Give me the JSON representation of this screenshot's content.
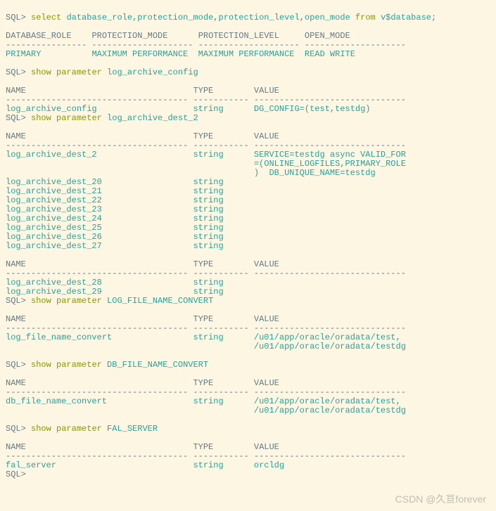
{
  "prompt": "SQL>",
  "cmd0": "select database_role,protection_mode,protection_level,open_mode from v$database;",
  "q0": {
    "hdr": [
      "DATABASE_ROLE",
      "PROTECTION_MODE",
      "PROTECTION_LEVEL",
      "OPEN_MODE"
    ],
    "dash": [
      "----------------",
      "--------------------",
      "--------------------",
      "--------------------"
    ],
    "row": [
      "PRIMARY",
      "MAXIMUM PERFORMANCE",
      "MAXIMUM PERFORMANCE",
      "READ WRITE"
    ]
  },
  "cmd1": "show parameter log_archive_config",
  "paramHdr": {
    "name": "NAME",
    "type": "TYPE",
    "value": "VALUE"
  },
  "paramDash": {
    "name": "------------------------------------",
    "type": "-----------",
    "value": "------------------------------"
  },
  "p1": [
    {
      "name": "log_archive_config",
      "type": "string",
      "value": "DG_CONFIG=(test,testdg)"
    }
  ],
  "cmd2": "show parameter log_archive_dest_2",
  "p2a": [
    {
      "name": "log_archive_dest_2",
      "type": "string",
      "value": "SERVICE=testdg async VALID_FOR"
    },
    {
      "name": "",
      "type": "",
      "value": "=(ONLINE_LOGFILES,PRIMARY_ROLE"
    },
    {
      "name": "",
      "type": "",
      "value": ")  DB_UNIQUE_NAME=testdg"
    },
    {
      "name": "log_archive_dest_20",
      "type": "string",
      "value": ""
    },
    {
      "name": "log_archive_dest_21",
      "type": "string",
      "value": ""
    },
    {
      "name": "log_archive_dest_22",
      "type": "string",
      "value": ""
    },
    {
      "name": "log_archive_dest_23",
      "type": "string",
      "value": ""
    },
    {
      "name": "log_archive_dest_24",
      "type": "string",
      "value": ""
    },
    {
      "name": "log_archive_dest_25",
      "type": "string",
      "value": ""
    },
    {
      "name": "log_archive_dest_26",
      "type": "string",
      "value": ""
    },
    {
      "name": "log_archive_dest_27",
      "type": "string",
      "value": ""
    }
  ],
  "p2b": [
    {
      "name": "log_archive_dest_28",
      "type": "string",
      "value": ""
    },
    {
      "name": "log_archive_dest_29",
      "type": "string",
      "value": ""
    }
  ],
  "cmd3": "show parameter LOG_FILE_NAME_CONVERT",
  "p3": [
    {
      "name": "log_file_name_convert",
      "type": "string",
      "value": "/u01/app/oracle/oradata/test,"
    },
    {
      "name": "",
      "type": "",
      "value": "/u01/app/oracle/oradata/testdg"
    }
  ],
  "cmd4": "show parameter DB_FILE_NAME_CONVERT",
  "p4": [
    {
      "name": "db_file_name_convert",
      "type": "string",
      "value": "/u01/app/oracle/oradata/test,"
    },
    {
      "name": "",
      "type": "",
      "value": "/u01/app/oracle/oradata/testdg"
    }
  ],
  "cmd5": "show parameter FAL_SERVER",
  "p5": [
    {
      "name": "fal_server",
      "type": "string",
      "value": "orcldg"
    }
  ],
  "watermark": "CSDN @久亘forever"
}
